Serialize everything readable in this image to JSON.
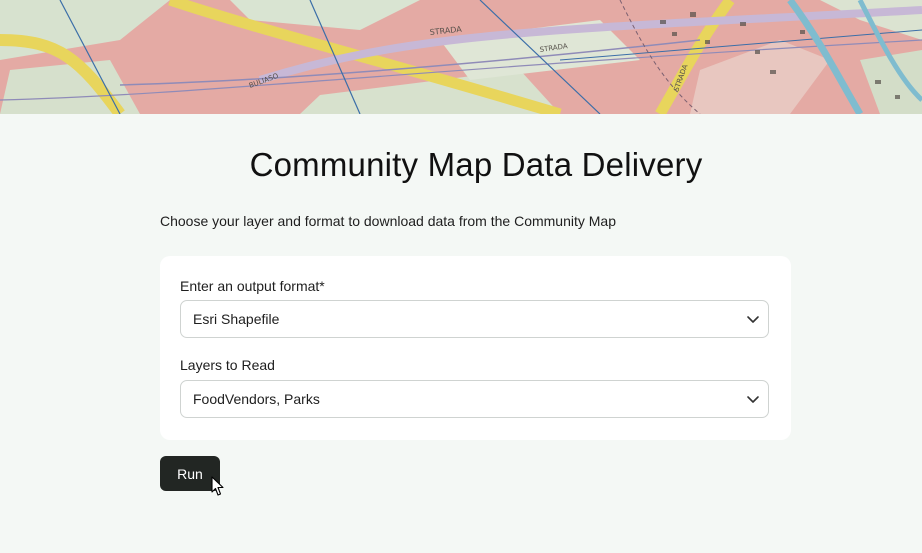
{
  "banner": {
    "description_icon": "map-banner-image",
    "street_labels": [
      "STRADA",
      "BULIASO",
      "STRADA",
      "STRADA"
    ]
  },
  "page": {
    "title": "Community Map Data Delivery",
    "subtitle": "Choose your layer and format to download data from the Community Map"
  },
  "form": {
    "output_format": {
      "label": "Enter an output format*",
      "value": "Esri Shapefile",
      "icon": "chevron-down-icon"
    },
    "layers": {
      "label": "Layers to Read",
      "value": "FoodVendors, Parks",
      "icon": "chevron-down-icon"
    }
  },
  "actions": {
    "run_label": "Run"
  },
  "colors": {
    "background": "#f4f8f5",
    "card": "#ffffff",
    "button": "#222623",
    "button_text": "#ffffff"
  }
}
